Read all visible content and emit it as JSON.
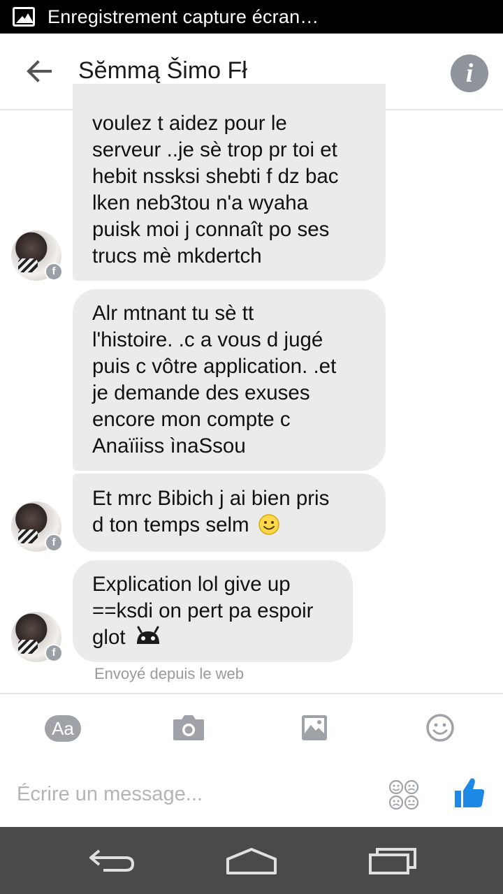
{
  "status_bar": {
    "notification": "Enregistrement capture écran…"
  },
  "header": {
    "title": "Sĕmmą Šimo Fł"
  },
  "messages": [
    {
      "lines": [
        "voulez t aidez pour le",
        "serveur ..je sè  trop pr toi et",
        "hebit nssksi shebti f dz bac",
        "lken neb3tou n'a wyaha",
        "puisk moi j connaît po ses",
        "trucs mè mkdertch"
      ]
    },
    {
      "lines": [
        "Alr mtnant tu sè tt",
        "l'histoire. .c a vous d jugé",
        "puis c vôtre application. .et",
        "je demande des exuses",
        "encore mon compte c",
        "Anaïiiss ìnaSsou"
      ]
    },
    {
      "lines": [
        "Et mrc Bibich j ai bien pris",
        "d ton temps selm"
      ],
      "emoji": "🙂"
    },
    {
      "lines": [
        "Explication lol give up",
        "==ksdi on pert pa espoir",
        "glot"
      ],
      "emoji": "android"
    }
  ],
  "sent_note": "Envoyé depuis le web",
  "composer": {
    "aa_label": "Aa",
    "placeholder": "Écrire un message...",
    "tools": [
      "text-format-icon",
      "camera-icon",
      "gallery-icon",
      "emoji-icon"
    ],
    "send_icon": "thumbs-up-icon"
  },
  "colors": {
    "bubble": "#ebebeb",
    "like": "#1e88e5",
    "navbar": "#4a4a4a"
  }
}
